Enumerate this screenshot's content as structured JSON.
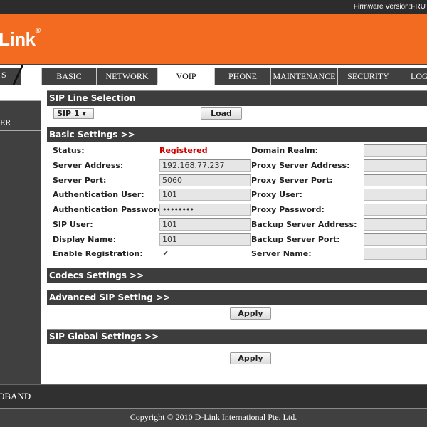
{
  "header": {
    "firmware": "Firmware Version:FRU",
    "logo_text": "-Link",
    "logo_mark": "®"
  },
  "nav": {
    "left_fragment": "S",
    "tabs": [
      {
        "label": "BASIC"
      },
      {
        "label": "NETWORK"
      },
      {
        "label": "VOIP"
      },
      {
        "label": "PHONE"
      },
      {
        "label": "MAINTENANCE"
      },
      {
        "label": "SECURITY"
      },
      {
        "label": "LOG"
      }
    ],
    "active_tab": "VOIP"
  },
  "sidebar": {
    "items": [
      {
        "label": ""
      },
      {
        "label": "ER"
      }
    ]
  },
  "sip_line": {
    "title": "SIP Line Selection",
    "selected": "SIP 1",
    "load_label": "Load"
  },
  "basic": {
    "title": "Basic Settings >>",
    "status_label": "Status:",
    "status_value": "Registered",
    "server_address_label": "Server Address:",
    "server_address": "192.168.77.237",
    "server_port_label": "Server Port:",
    "server_port": "5060",
    "auth_user_label": "Authentication User:",
    "auth_user": "101",
    "auth_password_label": "Authentication Password:",
    "auth_password": "••••••••",
    "sip_user_label": "SIP User:",
    "sip_user": "101",
    "display_name_label": "Display Name:",
    "display_name": "101",
    "enable_reg_label": "Enable Registration:",
    "enable_reg_checked": "✔",
    "domain_realm_label": "Domain Realm:",
    "domain_realm": "",
    "proxy_addr_label": "Proxy Server Address:",
    "proxy_addr": "",
    "proxy_port_label": "Proxy Server Port:",
    "proxy_port": "",
    "proxy_user_label": "Proxy User:",
    "proxy_user": "",
    "proxy_password_label": "Proxy Password:",
    "proxy_password": "",
    "backup_addr_label": "Backup Server Address:",
    "backup_addr": "",
    "backup_port_label": "Backup Server Port:",
    "backup_port": "",
    "server_name_label": "Server Name:",
    "server_name": ""
  },
  "codecs": {
    "title": "Codecs Settings >>"
  },
  "advanced": {
    "title": "Advanced SIP Setting >>",
    "apply_label": "Apply"
  },
  "global": {
    "title": "SIP Global Settings >>",
    "apply_label": "Apply"
  },
  "footer": {
    "broadband": "OBAND",
    "copyright": "Copyright © 2010 D-Link International Pte. Ltd."
  },
  "colors": {
    "brand_orange": "#f26b21",
    "dark_bar": "#404040",
    "status_red": "#d00000"
  }
}
